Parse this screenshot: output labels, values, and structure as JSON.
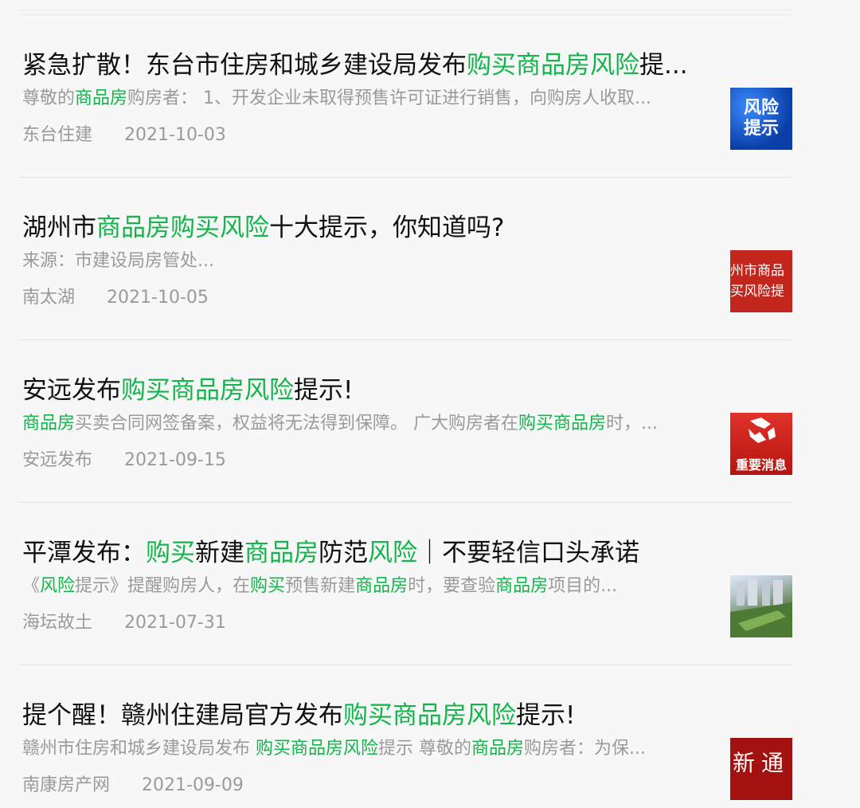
{
  "articles": [
    {
      "title_parts": [
        "紧急扩散！东台市住房和城乡建设局发布",
        "购买商品房风险",
        "提..."
      ],
      "summary_parts": [
        "尊敬的",
        "商品房",
        "购房者： 1、开发企业未取得预售许可证进行销售，向购房人收取..."
      ],
      "source": "东台住建",
      "date": "2021-10-03",
      "thumb_text": "风险提示"
    },
    {
      "title_parts": [
        "湖州市",
        "商品房购买风险",
        "十大提示，你知道吗?"
      ],
      "summary_parts": [
        "来源：市建设局房管处..."
      ],
      "source": "南太湖",
      "date": "2021-10-05",
      "thumb_line1": "州市商品",
      "thumb_line2": "买风险提"
    },
    {
      "title_parts": [
        "安远发布",
        "购买商品房风险",
        "提示!"
      ],
      "summary_parts": [
        "商品房",
        "买卖合同网签备案，权益将无法得到保障。 广大购房者在",
        "购买商品房",
        "时，..."
      ],
      "source": "安远发布",
      "date": "2021-09-15",
      "thumb_text": "重要消息"
    },
    {
      "title_parts": [
        "平潭发布：",
        "购买",
        "新建",
        "商品房",
        "防范",
        "风险",
        "｜不要轻信口头承诺"
      ],
      "summary_parts": [
        "《",
        "风险",
        "提示》提醒购房人，在",
        "购买",
        "预售新建",
        "商品房",
        "时，要查验",
        "商品房",
        "项目的..."
      ],
      "source": "海坛故土",
      "date": "2021-07-31"
    },
    {
      "title_parts": [
        "提个醒！赣州住建局官方发布",
        "购买商品房风险",
        "提示!"
      ],
      "summary_parts": [
        "赣州市住房和城乡建设局发布 ",
        "购买商品房风险",
        "提示 尊敬的",
        "商品房",
        "购房者：为保..."
      ],
      "source": "南康房产网",
      "date": "2021-09-09",
      "thumb_text": "新通"
    }
  ],
  "colors": {
    "highlight": "#13b44a",
    "title": "#111111",
    "muted": "#9a9a9a",
    "background": "#f7f7f7"
  }
}
